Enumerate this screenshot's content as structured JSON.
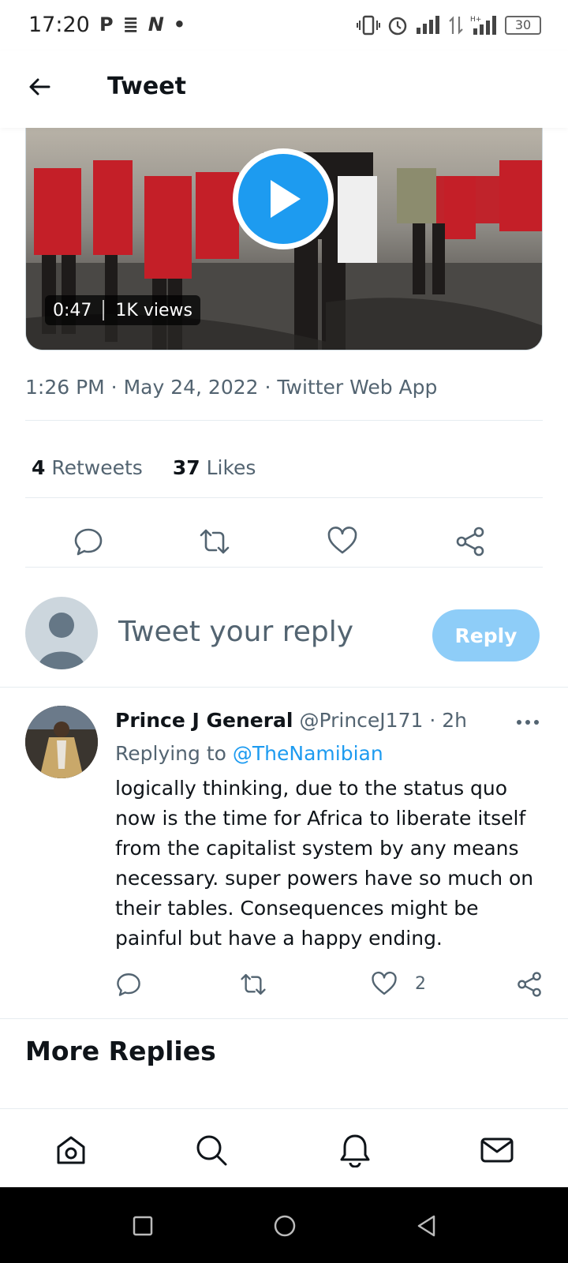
{
  "status_bar": {
    "time": "17:20",
    "left_icons": [
      "P",
      "≣",
      "N",
      "•"
    ],
    "battery": "30"
  },
  "header": {
    "title": "Tweet",
    "back_icon": "arrow-left-icon"
  },
  "video": {
    "duration": "0:47",
    "views": "1K views"
  },
  "tweet_meta": {
    "timestamp": "1:26 PM · May 24, 2022 · Twitter Web App"
  },
  "stats": {
    "retweets_count": "4",
    "retweets_label": "Retweets",
    "likes_count": "37",
    "likes_label": "Likes"
  },
  "actions": [
    "reply-icon",
    "retweet-icon",
    "like-icon",
    "share-icon"
  ],
  "composer": {
    "placeholder": "Tweet your reply",
    "reply_button": "Reply"
  },
  "reply": {
    "name": "Prince J General",
    "handle": "@PrinceJ171 · 2h",
    "replying_prefix": "Replying to",
    "replying_mention": "@TheNamibian",
    "text": "logically thinking, due to the status quo now is the time for Africa to liberate itself from the capitalist system by any means necessary. super powers have so much on their tables. Consequences might be painful but have a happy ending.",
    "like_count": "2"
  },
  "section_title": "More Replies",
  "bottom_nav": [
    "home-icon",
    "search-icon",
    "notifications-icon",
    "messages-icon"
  ],
  "colors": {
    "accent": "#1d9bf0",
    "reply_button_disabled": "#8ecdf8",
    "secondary_text": "#536471"
  }
}
